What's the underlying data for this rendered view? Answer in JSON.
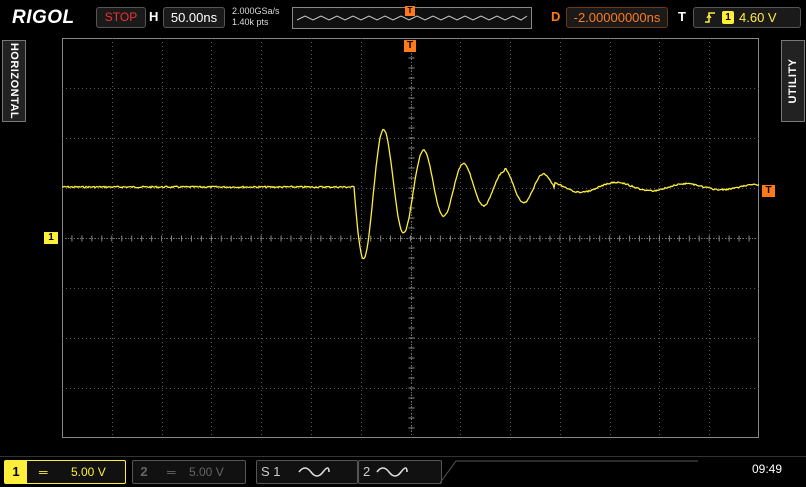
{
  "brand": "RIGOL",
  "status": "STOP",
  "horizontal": {
    "label": "H",
    "timebase": "50.00ns"
  },
  "acquisition": {
    "sample_rate": "2.000GSa/s",
    "points": "1.40k pts"
  },
  "delay": {
    "label": "D",
    "value": "-2.00000000ns"
  },
  "trigger": {
    "label": "T",
    "level": "4.60 V",
    "marker": "T",
    "source_badge": "1"
  },
  "side_tabs": {
    "left": "HORIZONTAL",
    "right": "UTILITY"
  },
  "channels": [
    {
      "number": "1",
      "coupling": "═",
      "scale": "5.00 V"
    },
    {
      "number": "2",
      "coupling": "═",
      "scale": "5.00 V"
    }
  ],
  "math": [
    {
      "label": "S",
      "number": "1"
    },
    {
      "label": "",
      "number": "2"
    }
  ],
  "markers": {
    "ch1_ground": "1",
    "trigger_level": "T"
  },
  "clock": "09:49",
  "colors": {
    "ch1": "#ffef3a",
    "trigger": "#ff7a1a",
    "stop": "#e33333",
    "grid": "#5a5a5a"
  }
}
